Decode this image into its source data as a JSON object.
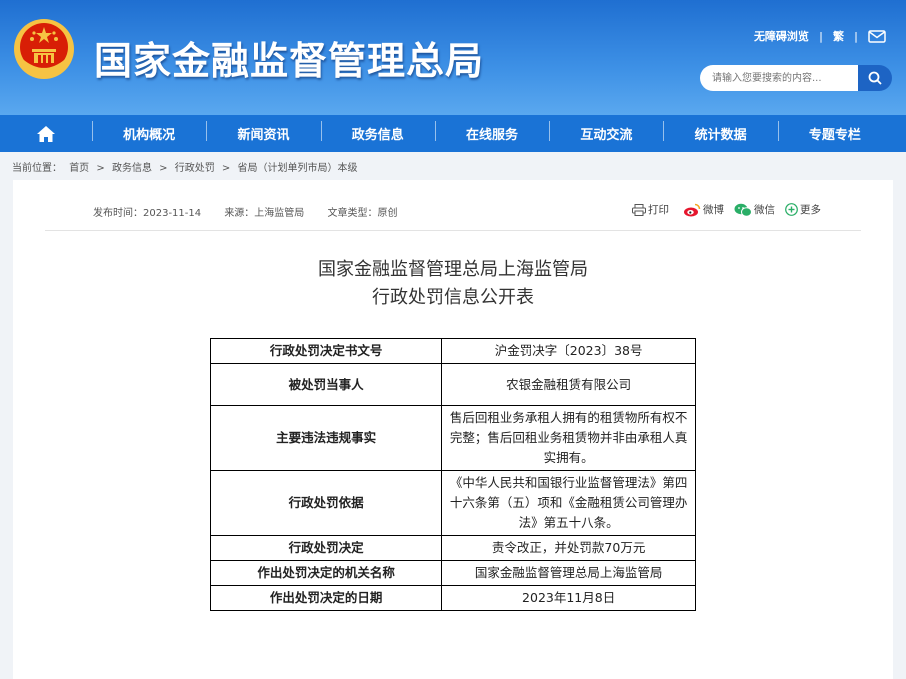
{
  "header": {
    "site_title": "国家金融监督管理总局",
    "accessibility_label": "无障碍浏览",
    "traditional_label": "繁",
    "search_placeholder": "请输入您要搜索的内容..."
  },
  "nav": {
    "items": [
      "机构概况",
      "新闻资讯",
      "政务信息",
      "在线服务",
      "互动交流",
      "统计数据",
      "专题专栏"
    ]
  },
  "breadcrumb": {
    "prefix": "当前位置：",
    "items": [
      "首页",
      "政务信息",
      "行政处罚",
      "省局（计划单列市局）本级"
    ],
    "separator": ">"
  },
  "article": {
    "publish_time": "发布时间：2023-11-14",
    "source": "来源：上海监管局",
    "doc_type": "文章类型：原创",
    "share": {
      "print": "打印",
      "weibo": "微博",
      "wechat": "微信",
      "more": "更多"
    },
    "title_line1": "国家金融监督管理总局上海监管局",
    "title_line2": "行政处罚信息公开表"
  },
  "penalty_table": {
    "rows": [
      {
        "key": "行政处罚决定书文号",
        "value": "沪金罚决字〔2023〕38号"
      },
      {
        "key": "被处罚当事人",
        "value": "农银金融租赁有限公司"
      },
      {
        "key": "主要违法违规事实",
        "value": "售后回租业务承租人拥有的租赁物所有权不完整；售后回租业务租赁物并非由承租人真实拥有。"
      },
      {
        "key": "行政处罚依据",
        "value": "《中华人民共和国银行业监督管理法》第四十六条第（五）项和《金融租赁公司管理办法》第五十八条。"
      },
      {
        "key": "行政处罚决定",
        "value": "责令改正，并处罚款70万元"
      },
      {
        "key": "作出处罚决定的机关名称",
        "value": "国家金融监督管理总局上海监管局"
      },
      {
        "key": "作出处罚决定的日期",
        "value": "2023年11月8日"
      }
    ]
  },
  "colors": {
    "header_blue": "#1f6fd1",
    "nav_blue": "#1a73d6",
    "emblem_red": "#d81e06",
    "emblem_gold": "#f6c343"
  }
}
